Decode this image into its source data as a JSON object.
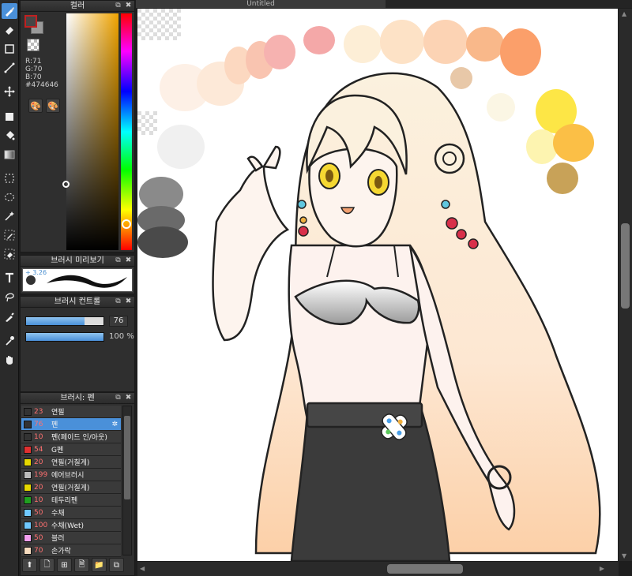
{
  "window": {
    "tab_title": "Untitled"
  },
  "color_panel": {
    "title": "컬러",
    "r_label": "R:71",
    "g_label": "G:70",
    "b_label": "B:70",
    "hex": "#474646",
    "fg_color": "#474646"
  },
  "brush_preview": {
    "title": "브러시 미리보기",
    "size": "3.26"
  },
  "brush_control": {
    "title": "브러시 컨트롤",
    "size_value": "76",
    "opacity_value": "100 %",
    "size_fraction": 0.76,
    "opacity_fraction": 1.0
  },
  "brush_list": {
    "title": "브러시: 펜",
    "items": [
      {
        "num": "23",
        "name": "연필",
        "color": "#333333"
      },
      {
        "num": "76",
        "name": "펜",
        "color": "#333333",
        "selected": true
      },
      {
        "num": "10",
        "name": "펜(페이드 인/아웃)",
        "color": "#333333"
      },
      {
        "num": "54",
        "name": "G펜",
        "color": "#e03030"
      },
      {
        "num": "20",
        "name": "연필(거칠게)",
        "color": "#e6d800"
      },
      {
        "num": "199",
        "name": "에어브러시",
        "color": "#bbbbbb"
      },
      {
        "num": "20",
        "name": "연필(거칠게)",
        "color": "#e6d800"
      },
      {
        "num": "10",
        "name": "테두리펜",
        "color": "#20a020"
      },
      {
        "num": "50",
        "name": "수채",
        "color": "#6fc8ff"
      },
      {
        "num": "100",
        "name": "수채(Wet)",
        "color": "#6fc8ff"
      },
      {
        "num": "50",
        "name": "블러",
        "color": "#f4a0f0"
      },
      {
        "num": "70",
        "name": "손가락",
        "color": "#f7dcc0"
      }
    ]
  },
  "tools": [
    "brush-icon",
    "eraser-icon",
    "rectangle-icon",
    "line-icon",
    "move-icon",
    "fill-rect-icon",
    "bucket-icon",
    "gradient-icon",
    "select-rect-icon",
    "select-lasso-icon",
    "magic-wand-icon",
    "select-pen-icon",
    "select-eraser-icon",
    "text-icon",
    "lasso-fill-icon",
    "eyedropper-pen-icon",
    "eyedropper-icon",
    "hand-icon"
  ]
}
